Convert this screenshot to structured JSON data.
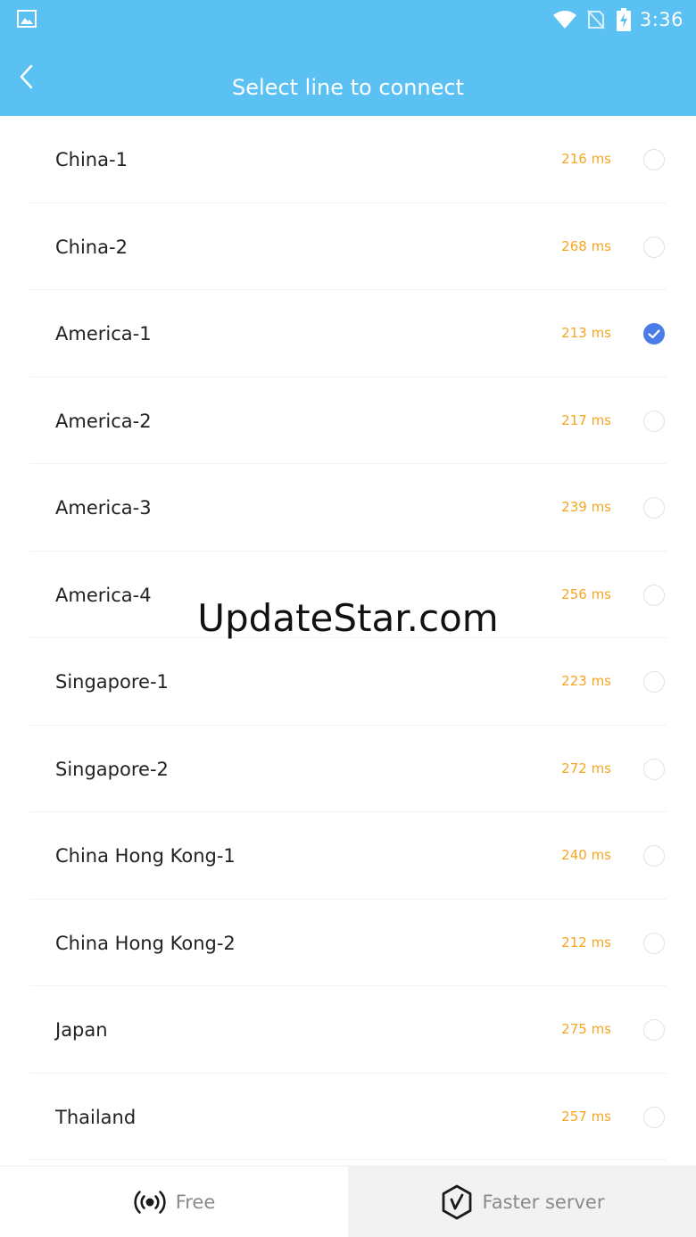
{
  "status_bar": {
    "time": "3:36"
  },
  "header": {
    "title": "Select line to connect"
  },
  "servers": [
    {
      "name": "China-1",
      "ping": "216 ms",
      "selected": false
    },
    {
      "name": "China-2",
      "ping": "268 ms",
      "selected": false
    },
    {
      "name": "America-1",
      "ping": "213 ms",
      "selected": true
    },
    {
      "name": "America-2",
      "ping": "217 ms",
      "selected": false
    },
    {
      "name": "America-3",
      "ping": "239 ms",
      "selected": false
    },
    {
      "name": "America-4",
      "ping": "256 ms",
      "selected": false
    },
    {
      "name": "Singapore-1",
      "ping": "223 ms",
      "selected": false
    },
    {
      "name": "Singapore-2",
      "ping": "272 ms",
      "selected": false
    },
    {
      "name": "China Hong Kong-1",
      "ping": "240 ms",
      "selected": false
    },
    {
      "name": "China Hong Kong-2",
      "ping": "212 ms",
      "selected": false
    },
    {
      "name": "Japan",
      "ping": "275 ms",
      "selected": false
    },
    {
      "name": "Thailand",
      "ping": "257 ms",
      "selected": false
    }
  ],
  "bottom_nav": {
    "free_label": "Free",
    "faster_label": "Faster server",
    "active_tab": "faster"
  },
  "watermark": "UpdateStar.com",
  "colors": {
    "header_bg": "#5bc0f2",
    "ping_text": "#f5a623",
    "selected_radio": "#4a7ce8"
  },
  "icons": {
    "status_left": "image-icon",
    "wifi": "wifi-icon",
    "signal": "no-signal-icon",
    "battery": "battery-charging-icon",
    "back": "chevron-left-icon",
    "free": "broadcast-icon",
    "faster": "speed-badge-icon"
  }
}
